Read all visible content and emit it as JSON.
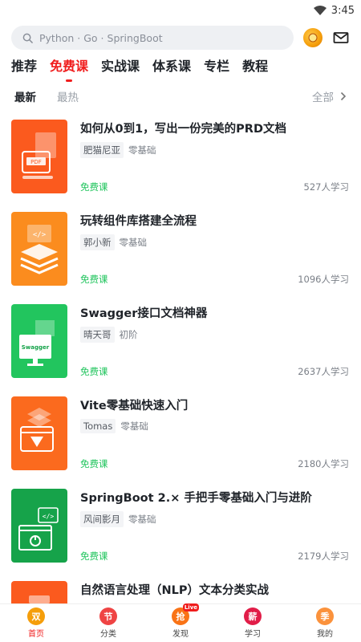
{
  "status_bar": {
    "time": "3:45"
  },
  "search": {
    "placeholder": "Python · Go · SpringBoot"
  },
  "tabs": [
    {
      "label": "推荐"
    },
    {
      "label": "免费课"
    },
    {
      "label": "实战课"
    },
    {
      "label": "体系课"
    },
    {
      "label": "专栏"
    },
    {
      "label": "教程"
    }
  ],
  "filters": {
    "newest": "最新",
    "hottest": "最热",
    "all": "全部"
  },
  "courses": [
    {
      "title": "如何从0到1，写出一份完美的PRD文档",
      "author": "肥猫尼亚",
      "level": "零基础",
      "price_label": "免费课",
      "learners": "527人学习",
      "thumb_label": "PDF",
      "thumb_color": "#fb5a1e",
      "thumb_icon": "pdf-document-icon"
    },
    {
      "title": "玩转组件库搭建全流程",
      "author": "郭小新",
      "level": "零基础",
      "price_label": "免费课",
      "learners": "1096人学习",
      "thumb_label": "</>",
      "thumb_color": "#fb8c1e",
      "thumb_icon": "layers-code-icon"
    },
    {
      "title": "Swagger接口文档神器",
      "author": "晴天哥",
      "level": "初阶",
      "price_label": "免费课",
      "learners": "2637人学习",
      "thumb_label": "Swagger",
      "thumb_color": "#22c55e",
      "thumb_icon": "monitor-icon"
    },
    {
      "title": "Vite零基础快速入门",
      "author": "Tomas",
      "level": "零基础",
      "price_label": "免费课",
      "learners": "2180人学习",
      "thumb_label": "",
      "thumb_color": "#fb6a1e",
      "thumb_icon": "vite-browser-icon"
    },
    {
      "title": "SpringBoot 2.× 手把手零基础入门与进阶",
      "author": "风间影月",
      "level": "零基础",
      "price_label": "免费课",
      "learners": "2179人学习",
      "thumb_label": "</>",
      "thumb_color": "#16a34a",
      "thumb_icon": "power-window-icon"
    },
    {
      "title": "自然语言处理（NLP）文本分类实战",
      "author": "",
      "level": "",
      "price_label": "",
      "learners": "",
      "thumb_label": "",
      "thumb_color": "#fb5a1e",
      "thumb_icon": "document-icon"
    }
  ],
  "bottom_nav": [
    {
      "label": "首页",
      "icon_char": "双",
      "color": "#f59e0b",
      "icon": "home-icon"
    },
    {
      "label": "分类",
      "icon_char": "节",
      "color": "#ef4444",
      "icon": "category-icon"
    },
    {
      "label": "发现",
      "icon_char": "抢",
      "color": "#f97316",
      "icon": "discover-icon",
      "badge": "Live"
    },
    {
      "label": "学习",
      "icon_char": "薪",
      "color": "#e11d48",
      "icon": "study-icon"
    },
    {
      "label": "我的",
      "icon_char": "季",
      "color": "#fb923c",
      "icon": "profile-icon"
    }
  ]
}
